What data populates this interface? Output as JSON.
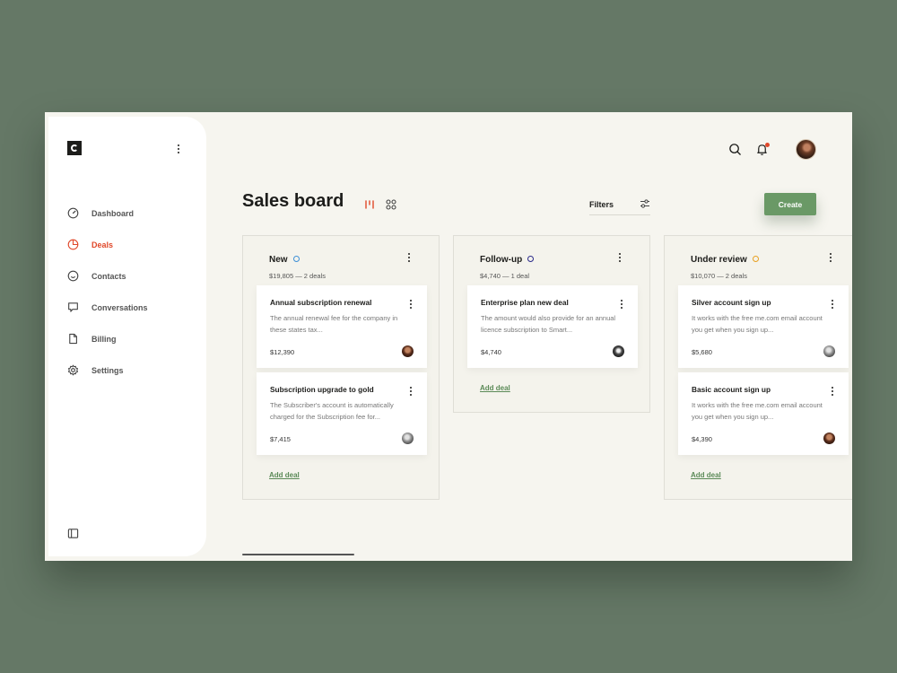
{
  "sidebar": {
    "items": [
      {
        "label": "Dashboard",
        "icon": "gauge-icon"
      },
      {
        "label": "Deals",
        "icon": "pie-chart-icon",
        "active": true
      },
      {
        "label": "Contacts",
        "icon": "smiley-icon"
      },
      {
        "label": "Conversations",
        "icon": "chat-icon"
      },
      {
        "label": "Billing",
        "icon": "document-icon"
      },
      {
        "label": "Settings",
        "icon": "gear-icon"
      }
    ]
  },
  "header": {
    "title": "Sales board",
    "filters_label": "Filters",
    "create_label": "Create"
  },
  "columns": [
    {
      "title": "New",
      "dot_color": "#3d8fd6",
      "summary": "$19,805 — 2 deals",
      "add_label": "Add deal",
      "cards": [
        {
          "title": "Annual subscription renewal",
          "desc": "The annual renewal fee for the company in these states tax...",
          "amount": "$12,390",
          "avatar": "av-a"
        },
        {
          "title": "Subscription upgrade to gold",
          "desc": "The Subscriber's account is automatically charged for the Subscription fee for...",
          "amount": "$7,415",
          "avatar": "av-b"
        }
      ]
    },
    {
      "title": "Follow-up",
      "dot_color": "#2a2a8a",
      "summary": "$4,740 — 1 deal",
      "add_label": "Add deal",
      "cards": [
        {
          "title": "Enterprise plan new deal",
          "desc": "The amount would also provide for an annual licence subscription to Smart...",
          "amount": "$4,740",
          "avatar": "av-c"
        }
      ]
    },
    {
      "title": "Under review",
      "dot_color": "#e8a020",
      "summary": "$10,070 — 2 deals",
      "add_label": "Add deal",
      "cards": [
        {
          "title": "Silver account sign up",
          "desc": "It works with the free me.com email account you get when you sign up...",
          "amount": "$5,680",
          "avatar": "av-b"
        },
        {
          "title": "Basic account sign up",
          "desc": "It works with the free me.com email account you get when you sign up...",
          "amount": "$4,390",
          "avatar": "av-a"
        }
      ]
    }
  ],
  "colors": {
    "accent": "#6a9966",
    "active": "#e0482a",
    "background": "#657866"
  }
}
